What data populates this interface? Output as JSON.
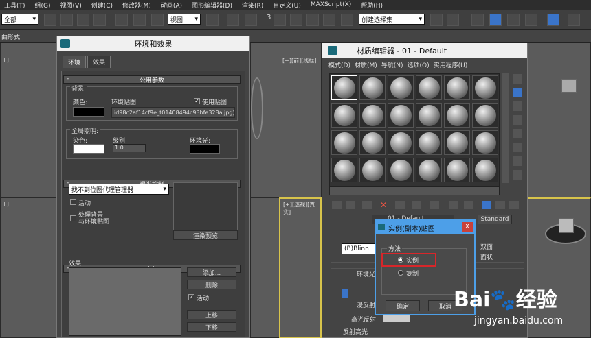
{
  "menubar": [
    "工具(T)",
    "组(G)",
    "视图(V)",
    "创建(C)",
    "修改器(M)",
    "动画(A)",
    "图形编辑器(D)",
    "渲染(R)",
    "自定义(U)",
    "MAXScript(X)",
    "帮助(H)"
  ],
  "toolbar": {
    "filter_value": "全部",
    "view_value": "视图",
    "sel_set_value": "创建选择集",
    "snap_value": "3"
  },
  "ribbon": {
    "label": "曲形式"
  },
  "viewports": {
    "top_left": "+]",
    "top_right": "[+][前][线框]",
    "bottom_left": "+]",
    "bottom_right": "[+][透视][真实]"
  },
  "env": {
    "title": "环境和效果",
    "tab_env": "环境",
    "tab_effects": "效果",
    "common_params": "公用参数",
    "background": "背景:",
    "color": "颜色:",
    "env_map": "环境贴图:",
    "use_map": "使用贴图",
    "map_name": "id98c2af14cf9e_t01408494c93bfe328a.jpg)",
    "global_lighting": "全局照明:",
    "tint": "染色:",
    "level": "级别:",
    "level_value": "1.0",
    "ambient": "环境光:",
    "exposure": "曝光控制",
    "exposure_select": "找不到位图代理管理器",
    "active": "活动",
    "process_bg": "处理背景",
    "with_env_map": "与环境贴图",
    "render_preview": "渲染预览",
    "atmosphere": "大气",
    "effects": "效果:",
    "add": "添加...",
    "delete": "删除",
    "active2": "活动",
    "move_up": "上移",
    "move_down": "下移",
    "minus": "-"
  },
  "mat": {
    "title": "材质编辑器 - 01 - Default",
    "menu": [
      "模式(D)",
      "材质(M)",
      "导航(N)",
      "选项(O)",
      "实用程序(U)"
    ],
    "name_field": "01 - Default",
    "standard": "Standard",
    "shader": "(B)Blinn",
    "two_sided": "双面",
    "faceted": "面状",
    "ambient": "环境光",
    "diffuse": "漫反射",
    "specular": "高光反射",
    "spec_highlights": "反射高光"
  },
  "popup": {
    "title": "实例(副本)贴图",
    "method": "方法",
    "instance": "实例",
    "copy": "复制",
    "ok": "确定",
    "cancel": "取消",
    "close": "X"
  },
  "watermark": {
    "brand": "Bai",
    "brand2": "经验",
    "url": "jingyan.baidu.com"
  }
}
